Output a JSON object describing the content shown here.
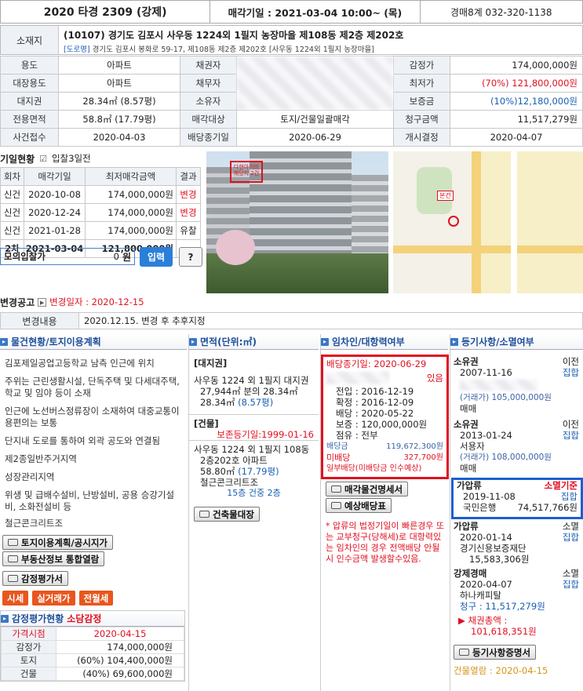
{
  "header": {
    "case_no": "2020 타경 2309 (강제)",
    "sale_date": "매각기일 : 2021-03-04 10:00~ (목)",
    "dept": "경매8계 032-320-1138"
  },
  "address": {
    "label": "소재지",
    "main": "(10107) 경기도 김포시 사우동 1224외 1필지 농장마을 제108동 제2층 제202호",
    "road_badge": "[도로명]",
    "road": "경기도 김포시 봉화로 59-17, 제108동 제2층 제202호 [사우동 1224외 1필지 농장마을]"
  },
  "info": {
    "use_l": "용도",
    "use_v": "아파트",
    "creditor_l": "채권자",
    "appr_l": "감정가",
    "appr_v": "174,000,000원",
    "mainuse_l": "대장용도",
    "mainuse_v": "아파트",
    "debtor_l": "채무자",
    "min_l": "최저가",
    "min_v": "(70%) 121,800,000원",
    "land_l": "대지권",
    "land_v": "28.34㎡ (8.57평)",
    "owner_l": "소유자",
    "dep_l": "보증금",
    "dep_v": "(10%)12,180,000원",
    "area_l": "전용면적",
    "area_v": "58.8㎡ (17.79평)",
    "target_l": "매각대상",
    "target_v": "토지/건물일괄매각",
    "claim_l": "청구금액",
    "claim_v": "11,517,279원",
    "recv_l": "사건접수",
    "recv_v": "2020-04-03",
    "divdl_l": "배당종기일",
    "divdl_v": "2020-06-29",
    "start_l": "개시결정",
    "start_v": "2020-04-07"
  },
  "history": {
    "title": "기일현황",
    "bid_note": "입찰3일전",
    "cols": [
      "회차",
      "매각기일",
      "최저매각금액",
      "결과"
    ],
    "rows": [
      [
        "신건",
        "2020-10-08",
        "174,000,000원",
        "변경"
      ],
      [
        "신건",
        "2020-12-24",
        "174,000,000원",
        "변경"
      ],
      [
        "신건",
        "2021-01-28",
        "174,000,000원",
        "유찰"
      ],
      [
        "2차",
        "2021-03-04",
        "121,800,000원",
        ""
      ]
    ]
  },
  "mock": {
    "label": "모의입찰가",
    "value": "0",
    "unit": "원",
    "enter": "입력",
    "help": "?"
  },
  "photo": {
    "sign": "다현아이비 해당지 2건"
  },
  "map": {
    "tag": "본건"
  },
  "change": {
    "title": "변경공고",
    "date": "변경일자 : 2020-12-15",
    "content_l": "변경내용",
    "content_v": "2020.12.15. 변경 후 추후지정"
  },
  "col1": {
    "title": "물건현황/토지이용계획",
    "paras": [
      "김포제일공업고등학교 남측 인근에 위치",
      "주위는 근린생활시설, 단독주택 및 다세대주택, 학교 및 임야 등이 소재",
      "인근에 노선버스정류장이 소재하여 대중교통이용편의는 보통",
      "단지내 도로를 통하여 외곽 공도와 연결됨",
      "제2종일반주거지역",
      "성장관리지역",
      "위생 및 급배수설비, 난방설비, 공용 승강기설비, 소화전설비 등",
      "철근콘크리트조"
    ],
    "btn1": "토지이용계획/공시지가",
    "btn2": "부동산정보 통합열람",
    "btn3": "감정평가서",
    "tags": [
      "시세",
      "실거래가",
      "전월세"
    ],
    "appr_title": "감정평가현황",
    "appr_link": "소담감정",
    "appr_rows": [
      [
        "가격시점",
        "2020-04-15"
      ],
      [
        "감정가",
        "174,000,000원"
      ],
      [
        "토지",
        "(60%) 104,400,000원"
      ],
      [
        "건물",
        "(40%) 69,600,000원"
      ]
    ]
  },
  "col2": {
    "title": "면적(단위:㎡)",
    "land_h": "[대지권]",
    "land_t1": "사우동 1224 외 1필지 대지권",
    "land_t2": "27,944㎡ 분의 28.34㎡",
    "land_t3": "28.34㎡",
    "land_t3b": "(8.57평)",
    "bld_h": "[건물]",
    "bld_reg": "보존등기일:1999-01-16",
    "bld_t1": "사우동 1224 외 1필지 108동",
    "bld_t2": "2층202호 아파트",
    "bld_t3": "58.80㎡",
    "bld_t3b": "(17.79평)",
    "bld_t4": "철근콘크리트조",
    "bld_t5": "15층 건중 2층",
    "btn": "건축물대장"
  },
  "col3": {
    "title": "임차인/대항력여부",
    "deadline": "배당종기일: 2020-06-29",
    "exists": "있음",
    "rows": [
      [
        "전입",
        "2016-12-19"
      ],
      [
        "확정",
        "2016-12-09"
      ],
      [
        "배당",
        "2020-05-22"
      ],
      [
        "보증",
        "120,000,000원"
      ],
      [
        "점유",
        "전부"
      ]
    ],
    "div_l": "배당금",
    "div_v": "119,672,300원",
    "undiv_l": "미배당",
    "undiv_v": "327,700원",
    "note": "일부배당(미배당금 인수예상)",
    "btn1": "매각물건명세서",
    "btn2": "예상배당표",
    "warn": "* 압류의 법정기일이 빠른경우 또는 교부청구(당해세)로 대항력있는 임차인의 경우 전액배당 안될시 인수금액 발생할수있음."
  },
  "col4": {
    "title": "등기사항/소멸여부",
    "e1": {
      "type": "소유권",
      "status": "이전",
      "date": "2007-11-16",
      "link": "집합",
      "price": "(거래가) 105,000,000원",
      "kind": "매매"
    },
    "e2": {
      "type": "소유권",
      "status": "이전",
      "date": "2013-01-24",
      "link": "집합",
      "name": "서용자",
      "price": "(거래가) 108,000,000원",
      "kind": "매매"
    },
    "e3": {
      "type": "가압류",
      "status": "소멸기준",
      "date": "2019-11-08",
      "link": "집합",
      "name": "국민은행",
      "amount": "74,517,766원"
    },
    "e4": {
      "type": "가압류",
      "status": "소멸",
      "date": "2020-01-14",
      "link": "집합",
      "name": "경기신용보증재단",
      "amount": "15,583,306원"
    },
    "e5": {
      "type": "강제경매",
      "status": "소멸",
      "date": "2020-04-07",
      "link": "집합",
      "name": "하나캐피탈",
      "claim": "청구 : 11,517,279원"
    },
    "total_l": "채권총액 :",
    "total_v": "101,618,351원",
    "btn": "등기사항증명서",
    "view": "건물열람 : 2020-04-15"
  }
}
